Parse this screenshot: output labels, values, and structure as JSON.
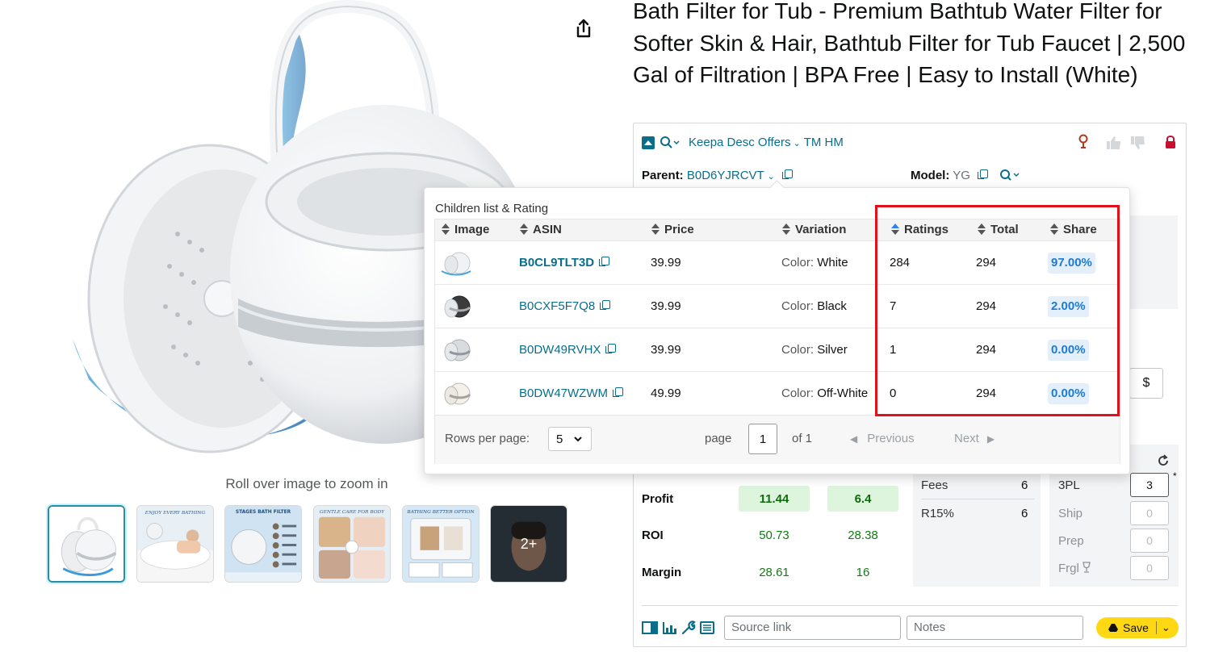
{
  "product": {
    "title": "Bath Filter for Tub - Premium Bathtub Water Filter for Softer Skin & Hair, Bathtub Filter for Tub Faucet | 2,500 Gal of Filtration | BPA Free | Easy to Install (White)",
    "zoom_hint": "Roll over image to zoom in",
    "more_thumbs": "2+"
  },
  "thumbnail_captions": {
    "t2": "ENJOY EVERY BATHING",
    "t3": "STAGES BATH FILTER",
    "t4": "GENTLE CARE FOR BODY",
    "t5": "BATHING BETTER OPTION"
  },
  "keepa": {
    "links": [
      "Keepa",
      "Desc",
      "Offers",
      "TM",
      "HM"
    ],
    "parent_label": "Parent:",
    "parent_asin": "B0D6YJRCVT",
    "model_label": "Model:",
    "model_value": "YG",
    "currency_symbol": "$",
    "profit_label": "Profit",
    "roi_label": "ROI",
    "margin_label": "Margin",
    "profit_values": [
      "11.44",
      "6.4"
    ],
    "roi_values": [
      "50.73",
      "28.38"
    ],
    "margin_values": [
      "28.61",
      "16"
    ],
    "fees_label": "Fees",
    "fees_value": "6",
    "r15_label": "R15%",
    "r15_value": "6",
    "three_pl_label": "3PL",
    "three_pl_value": "3",
    "ship_label": "Ship",
    "ship_value": "0",
    "prep_label": "Prep",
    "prep_value": "0",
    "frgl_label": "Frgl",
    "frgl_value": "0",
    "source_placeholder": "Source link",
    "notes_placeholder": "Notes",
    "save_label": "Save"
  },
  "popup": {
    "title": "Children list & Rating",
    "headers": {
      "image": "Image",
      "asin": "ASIN",
      "price": "Price",
      "variation": "Variation",
      "ratings": "Ratings",
      "total": "Total",
      "share": "Share"
    },
    "rows": [
      {
        "asin": "B0CL9TLT3D",
        "price": "39.99",
        "var_label": "Color:",
        "var_value": "White",
        "ratings": "284",
        "total": "294",
        "share": "97.00%"
      },
      {
        "asin": "B0CXF5F7Q8",
        "price": "39.99",
        "var_label": "Color:",
        "var_value": "Black",
        "ratings": "7",
        "total": "294",
        "share": "2.00%"
      },
      {
        "asin": "B0DW49RVHX",
        "price": "39.99",
        "var_label": "Color:",
        "var_value": "Silver",
        "ratings": "1",
        "total": "294",
        "share": "0.00%"
      },
      {
        "asin": "B0DW47WZWM",
        "price": "49.99",
        "var_label": "Color:",
        "var_value": "Off-White",
        "ratings": "0",
        "total": "294",
        "share": "0.00%"
      }
    ],
    "footer": {
      "rows_per_page_label": "Rows per page:",
      "rows_per_page_value": "5",
      "page_label": "page",
      "page_value": "1",
      "of_label": "of 1",
      "previous_label": "Previous",
      "next_label": "Next"
    }
  },
  "colors": {
    "link": "#0a6e8a",
    "highlight": "#e0101c",
    "save_button": "#ffd814",
    "share_pill": "#e3f0fb"
  }
}
